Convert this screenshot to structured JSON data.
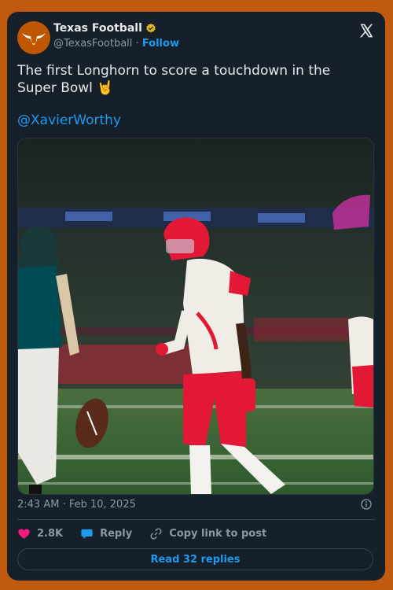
{
  "account": {
    "name": "Texas Football",
    "handle": "@TexasFootball",
    "separator": " · ",
    "follow_label": "Follow"
  },
  "tweet": {
    "text": "The first Longhorn to score a touchdown in the Super Bowl 🤘",
    "mention": "@XavierWorthy",
    "timestamp": "2:43 AM · Feb 10, 2025"
  },
  "actions": {
    "likes_count": "2.8K",
    "reply_label": "Reply",
    "copy_link_label": "Copy link to post",
    "read_replies_label": "Read 32 replies"
  },
  "colors": {
    "page_background": "#c05a10",
    "card_background": "#15202b",
    "accent": "#1d9bf0",
    "like": "#f91880",
    "brand": "#bf5700",
    "chiefs_red": "#e31837",
    "eagles_green": "#004c54"
  },
  "icons": [
    "longhorn-logo-icon",
    "verified-badge-icon",
    "x-logo-icon",
    "info-icon",
    "heart-icon",
    "reply-bubble-icon",
    "link-icon"
  ]
}
